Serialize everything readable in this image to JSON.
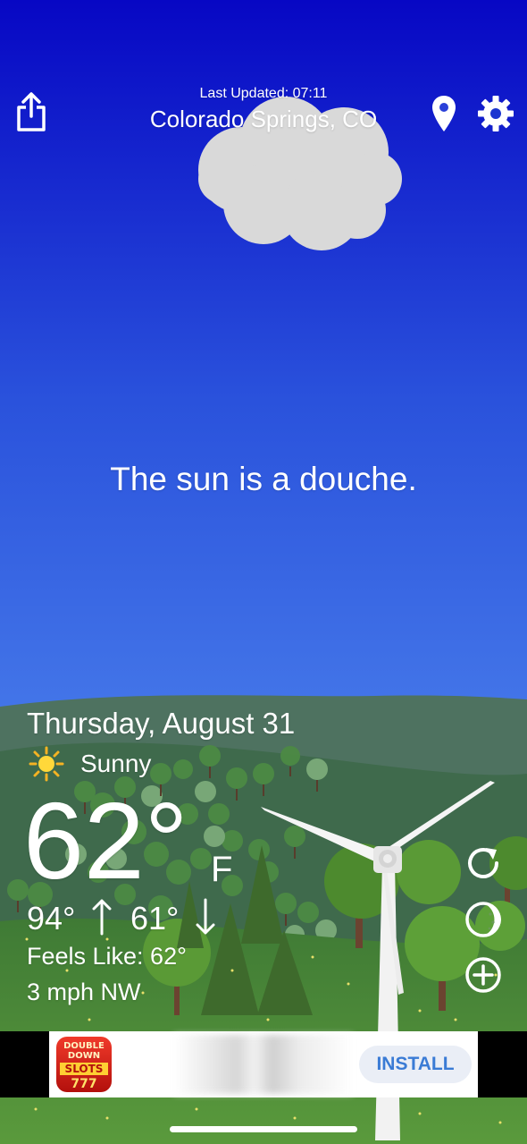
{
  "header": {
    "last_updated": "Last Updated: 07:11",
    "location": "Colorado Springs, CO",
    "share_icon": "share-icon",
    "location_icon": "map-pin-icon",
    "settings_icon": "gear-icon"
  },
  "main": {
    "quip": "The sun is a douche."
  },
  "weather": {
    "date": "Thursday, August 31",
    "condition": "Sunny",
    "condition_icon": "sun-icon",
    "temperature": "62°",
    "unit": "F",
    "high": "94°",
    "low": "61°",
    "feels_like": "Feels Like: 62°",
    "wind": "3 mph NW"
  },
  "side_actions": [
    {
      "icon": "refresh-icon"
    },
    {
      "icon": "moon-phase-icon"
    },
    {
      "icon": "add-circle-icon"
    }
  ],
  "ad": {
    "logo_line1": "DOUBLE",
    "logo_line2": "DOWN",
    "logo_line3": "SLOTS",
    "logo_line4": "777",
    "install_label": "INSTALL"
  },
  "colors": {
    "sky_top": "#0909c6",
    "sky_mid": "#3a6de6",
    "sky_bottom": "#62a4f4",
    "hill_far": "#4a6f5a",
    "grass": "#4e8e3a",
    "install_text": "#3a7bd5"
  }
}
